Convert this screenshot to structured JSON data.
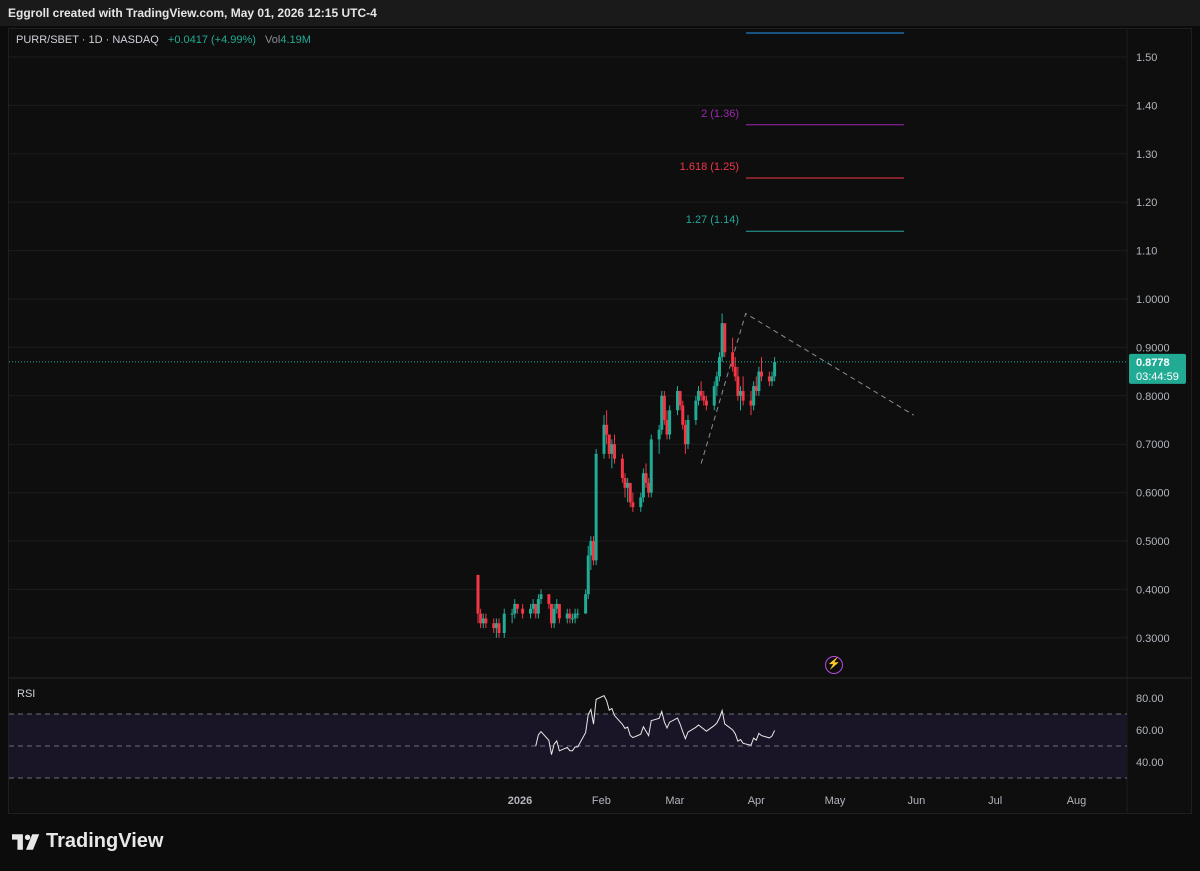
{
  "credit": "Eggroll created with TradingView.com, May 01, 2026 12:15 UTC-4",
  "legend": {
    "symbol": "PURR/SBET · 1D · NASDAQ",
    "change": "+0.0417 (+4.99%)",
    "vol_label": "Vol",
    "vol_value": "4.19M"
  },
  "price_badge": {
    "price": "0.8778",
    "countdown": "03:44:59"
  },
  "brand": "TradingView",
  "rsi_label": "RSI",
  "colors": {
    "up": "#22ab94",
    "down": "#f23645",
    "fib_127": "#26a69a",
    "fib_1618": "#f23645",
    "fib_2": "#9c27b0",
    "fib_top": "#2196f3"
  },
  "chart_data": {
    "type": "candlestick",
    "title": "",
    "ylim": [
      0.22,
      1.57
    ],
    "y_ticks": [
      {
        "value": 1.5,
        "label": "1.50"
      },
      {
        "value": 1.4,
        "label": "1.40"
      },
      {
        "value": 1.3,
        "label": "1.30"
      },
      {
        "value": 1.2,
        "label": "1.20"
      },
      {
        "value": 1.1,
        "label": "1.10"
      },
      {
        "value": 1.0,
        "label": "1.0000"
      },
      {
        "value": 0.9,
        "label": "0.9000"
      },
      {
        "value": 0.8,
        "label": "0.8000"
      },
      {
        "value": 0.7,
        "label": "0.7000"
      },
      {
        "value": 0.6,
        "label": "0.6000"
      },
      {
        "value": 0.5,
        "label": "0.5000"
      },
      {
        "value": 0.4,
        "label": "0.4000"
      },
      {
        "value": 0.3,
        "label": "0.3000"
      }
    ],
    "x_ticks": [
      "2026",
      "Feb",
      "Mar",
      "Apr",
      "May",
      "Jun",
      "Jul",
      "Aug"
    ],
    "fib_levels": [
      {
        "label": "1.27 (1.14)",
        "value": 1.14,
        "color": "#26a69a"
      },
      {
        "label": "1.618 (1.25)",
        "value": 1.25,
        "color": "#f23645"
      },
      {
        "label": "2 (1.36)",
        "value": 1.36,
        "color": "#9c27b0"
      }
    ],
    "trendline": [
      [
        "2026-03-11",
        0.66
      ],
      [
        "2026-03-28",
        0.97
      ],
      [
        "2026-05-31",
        0.76
      ]
    ],
    "candles": [
      [
        "2025-12-16",
        0.43,
        0.43,
        0.33,
        0.35
      ],
      [
        "2025-12-17",
        0.35,
        0.36,
        0.32,
        0.33
      ],
      [
        "2025-12-18",
        0.33,
        0.35,
        0.32,
        0.34
      ],
      [
        "2025-12-19",
        0.34,
        0.35,
        0.32,
        0.33
      ],
      [
        "2025-12-22",
        0.33,
        0.34,
        0.31,
        0.32
      ],
      [
        "2025-12-23",
        0.32,
        0.34,
        0.3,
        0.33
      ],
      [
        "2025-12-24",
        0.33,
        0.34,
        0.3,
        0.31
      ],
      [
        "2025-12-26",
        0.31,
        0.36,
        0.3,
        0.35
      ],
      [
        "2025-12-29",
        0.35,
        0.36,
        0.33,
        0.35
      ],
      [
        "2025-12-30",
        0.35,
        0.38,
        0.34,
        0.37
      ],
      [
        "2025-12-31",
        0.37,
        0.37,
        0.35,
        0.36
      ],
      [
        "2026-01-02",
        0.36,
        0.37,
        0.34,
        0.35
      ],
      [
        "2026-01-05",
        0.35,
        0.37,
        0.34,
        0.36
      ],
      [
        "2026-01-06",
        0.36,
        0.38,
        0.35,
        0.37
      ],
      [
        "2026-01-07",
        0.37,
        0.37,
        0.34,
        0.35
      ],
      [
        "2026-01-08",
        0.35,
        0.39,
        0.34,
        0.38
      ],
      [
        "2026-01-09",
        0.38,
        0.4,
        0.37,
        0.39
      ],
      [
        "2026-01-12",
        0.39,
        0.39,
        0.36,
        0.37
      ],
      [
        "2026-01-13",
        0.37,
        0.37,
        0.32,
        0.33
      ],
      [
        "2026-01-14",
        0.33,
        0.37,
        0.32,
        0.36
      ],
      [
        "2026-01-15",
        0.36,
        0.38,
        0.35,
        0.37
      ],
      [
        "2026-01-16",
        0.37,
        0.37,
        0.33,
        0.34
      ],
      [
        "2026-01-19",
        0.34,
        0.36,
        0.33,
        0.35
      ],
      [
        "2026-01-20",
        0.35,
        0.36,
        0.33,
        0.34
      ],
      [
        "2026-01-21",
        0.34,
        0.35,
        0.33,
        0.34
      ],
      [
        "2026-01-22",
        0.34,
        0.36,
        0.33,
        0.35
      ],
      [
        "2026-01-23",
        0.35,
        0.36,
        0.34,
        0.35
      ],
      [
        "2026-01-26",
        0.35,
        0.4,
        0.35,
        0.39
      ],
      [
        "2026-01-27",
        0.39,
        0.49,
        0.38,
        0.47
      ],
      [
        "2026-01-28",
        0.47,
        0.51,
        0.44,
        0.5
      ],
      [
        "2026-01-29",
        0.5,
        0.51,
        0.45,
        0.46
      ],
      [
        "2026-01-30",
        0.46,
        0.69,
        0.45,
        0.68
      ],
      [
        "2026-02-02",
        0.68,
        0.76,
        0.67,
        0.74
      ],
      [
        "2026-02-03",
        0.74,
        0.77,
        0.7,
        0.72
      ],
      [
        "2026-02-04",
        0.72,
        0.72,
        0.67,
        0.68
      ],
      [
        "2026-02-05",
        0.68,
        0.71,
        0.65,
        0.7
      ],
      [
        "2026-02-06",
        0.7,
        0.72,
        0.66,
        0.67
      ],
      [
        "2026-02-09",
        0.67,
        0.68,
        0.62,
        0.63
      ],
      [
        "2026-02-10",
        0.63,
        0.64,
        0.59,
        0.61
      ],
      [
        "2026-02-11",
        0.61,
        0.63,
        0.58,
        0.62
      ],
      [
        "2026-02-12",
        0.62,
        0.62,
        0.57,
        0.58
      ],
      [
        "2026-02-13",
        0.58,
        0.6,
        0.56,
        0.57
      ],
      [
        "2026-02-16",
        0.57,
        0.6,
        0.56,
        0.59
      ],
      [
        "2026-02-17",
        0.59,
        0.65,
        0.58,
        0.64
      ],
      [
        "2026-02-18",
        0.64,
        0.66,
        0.61,
        0.62
      ],
      [
        "2026-02-19",
        0.62,
        0.63,
        0.59,
        0.6
      ],
      [
        "2026-02-20",
        0.6,
        0.72,
        0.59,
        0.71
      ],
      [
        "2026-02-23",
        0.71,
        0.74,
        0.68,
        0.73
      ],
      [
        "2026-02-24",
        0.73,
        0.81,
        0.72,
        0.8
      ],
      [
        "2026-02-25",
        0.8,
        0.81,
        0.74,
        0.75
      ],
      [
        "2026-02-26",
        0.75,
        0.77,
        0.71,
        0.72
      ],
      [
        "2026-02-27",
        0.72,
        0.78,
        0.71,
        0.77
      ],
      [
        "2026-03-02",
        0.77,
        0.82,
        0.76,
        0.81
      ],
      [
        "2026-03-03",
        0.81,
        0.81,
        0.77,
        0.78
      ],
      [
        "2026-03-04",
        0.78,
        0.79,
        0.73,
        0.74
      ],
      [
        "2026-03-05",
        0.74,
        0.75,
        0.68,
        0.7
      ],
      [
        "2026-03-06",
        0.7,
        0.76,
        0.69,
        0.75
      ],
      [
        "2026-03-09",
        0.75,
        0.8,
        0.74,
        0.79
      ],
      [
        "2026-03-10",
        0.79,
        0.82,
        0.78,
        0.81
      ],
      [
        "2026-03-11",
        0.81,
        0.83,
        0.79,
        0.8
      ],
      [
        "2026-03-12",
        0.8,
        0.81,
        0.78,
        0.79
      ],
      [
        "2026-03-13",
        0.79,
        0.8,
        0.77,
        0.78
      ],
      [
        "2026-03-16",
        0.78,
        0.83,
        0.77,
        0.82
      ],
      [
        "2026-03-17",
        0.82,
        0.85,
        0.8,
        0.84
      ],
      [
        "2026-03-18",
        0.84,
        0.89,
        0.83,
        0.88
      ],
      [
        "2026-03-19",
        0.88,
        0.97,
        0.87,
        0.95
      ],
      [
        "2026-03-20",
        0.95,
        0.95,
        0.88,
        0.89
      ],
      [
        "2026-03-23",
        0.89,
        0.92,
        0.85,
        0.86
      ],
      [
        "2026-03-24",
        0.86,
        0.88,
        0.83,
        0.84
      ],
      [
        "2026-03-25",
        0.84,
        0.86,
        0.79,
        0.8
      ],
      [
        "2026-03-26",
        0.8,
        0.82,
        0.77,
        0.81
      ],
      [
        "2026-03-27",
        0.81,
        0.84,
        0.78,
        0.79
      ],
      [
        "2026-03-30",
        0.79,
        0.81,
        0.76,
        0.78
      ],
      [
        "2026-03-31",
        0.78,
        0.83,
        0.77,
        0.82
      ],
      [
        "2026-04-01",
        0.82,
        0.84,
        0.8,
        0.81
      ],
      [
        "2026-04-02",
        0.81,
        0.86,
        0.8,
        0.85
      ],
      [
        "2026-04-03",
        0.85,
        0.88,
        0.83,
        0.84
      ],
      [
        "2026-04-06",
        0.84,
        0.85,
        0.82,
        0.83
      ],
      [
        "2026-04-07",
        0.83,
        0.85,
        0.82,
        0.84
      ],
      [
        "2026-04-08",
        0.84,
        0.88,
        0.83,
        0.87
      ]
    ]
  }
}
